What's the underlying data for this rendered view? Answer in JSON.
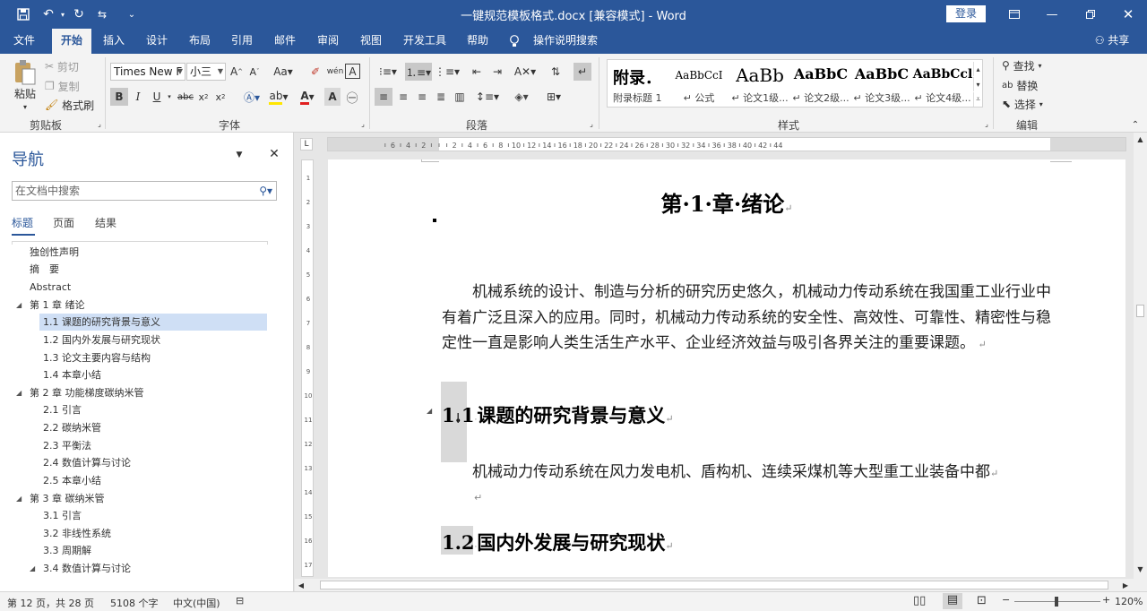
{
  "titlebar": {
    "title": "一键规范模板格式.docx [兼容模式]  -  Word",
    "login": "登录",
    "quick_access": [
      "save-icon",
      "undo-icon",
      "redo-icon",
      "touch-mode-icon",
      "customize-icon"
    ]
  },
  "tabs": [
    "文件",
    "开始",
    "插入",
    "设计",
    "布局",
    "引用",
    "邮件",
    "审阅",
    "视图",
    "开发工具",
    "帮助"
  ],
  "tell_me": "操作说明搜索",
  "share": "共享",
  "clipboard": {
    "paste": "粘贴",
    "cut": "剪切",
    "copy": "复制",
    "format_painter": "格式刷",
    "group": "剪贴板"
  },
  "font": {
    "name": "Times New F",
    "size": "小三",
    "group": "字体"
  },
  "paragraph": {
    "group": "段落"
  },
  "styles": {
    "group": "样式",
    "items": [
      {
        "preview": "附录．",
        "label": "附录标题 1"
      },
      {
        "preview": "AaBbCcI",
        "label": "↵ 公式"
      },
      {
        "preview": "AaBb",
        "label": "↵ 论文1级..."
      },
      {
        "preview": "AaBbC",
        "label": "↵ 论文2级..."
      },
      {
        "preview": "AaBbC",
        "label": "↵ 论文3级..."
      },
      {
        "preview": "AaBbCcl",
        "label": "↵ 论文4级..."
      }
    ]
  },
  "editing": {
    "find": "查找",
    "replace": "替换",
    "select": "选择",
    "group": "编辑"
  },
  "nav": {
    "title": "导航",
    "search_placeholder": "在文档中搜索",
    "tabs": [
      "标题",
      "页面",
      "结果"
    ],
    "items": [
      {
        "text": "独创性声明"
      },
      {
        "text": "摘　要"
      },
      {
        "text": "Abstract"
      },
      {
        "text": "第 1 章 绪论"
      },
      {
        "text": "1.1 课题的研究背景与意义"
      },
      {
        "text": "1.2 国内外发展与研究现状"
      },
      {
        "text": "1.3 论文主要内容与结构"
      },
      {
        "text": "1.4 本章小结"
      },
      {
        "text": "第 2 章 功能梯度碳纳米管"
      },
      {
        "text": "2.1 引言"
      },
      {
        "text": "2.2 碳纳米管"
      },
      {
        "text": "2.3 平衡法"
      },
      {
        "text": "2.4 数值计算与讨论"
      },
      {
        "text": "2.5 本章小结"
      },
      {
        "text": "第 3 章 碳纳米管"
      },
      {
        "text": "3.1 引言"
      },
      {
        "text": "3.2 非线性系统"
      },
      {
        "text": "3.3 周期解"
      },
      {
        "text": "3.4 数值计算与讨论"
      }
    ]
  },
  "document": {
    "chapter_title": "第·1·章·绪论",
    "para1": "机械系统的设计、制造与分析的研究历史悠久，机械动力传动系统在我国重工业行业中有着广泛且深入的应用。同时，机械动力传动系统的安全性、高效性、可靠性、精密性与稳定性一直是影响人类生活生产水平、企业经济效益与吸引各界关注的重要课题。",
    "h1_num": "1.1",
    "h1_text": "课题的研究背景与意义",
    "para2": "机械动力传动系统在风力发电机、盾构机、连续采煤机等大型重工业装备中都",
    "h2_num": "1.2",
    "h2_text": "国内外发展与研究现状"
  },
  "status": {
    "page": "第 12 页，共 28 页",
    "words": "5108 个字",
    "language": "中文(中国)",
    "zoom": "120%"
  },
  "colors": {
    "accent": "#2b579a"
  }
}
